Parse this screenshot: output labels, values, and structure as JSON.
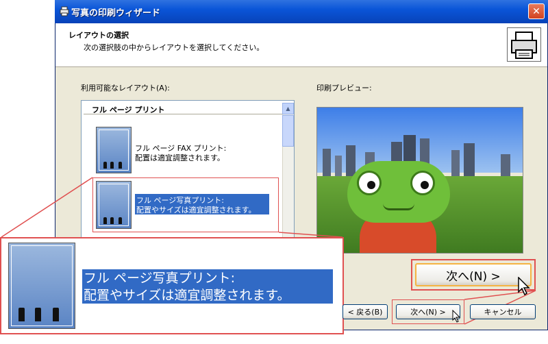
{
  "window": {
    "title": "写真の印刷ウィザード",
    "close_label": "✕"
  },
  "header": {
    "title": "レイアウトの選択",
    "subtitle": "次の選択肢の中からレイアウトを選択してください。"
  },
  "layouts": {
    "label": "利用可能なレイアウト(A):",
    "group": "フル ページ プリント",
    "items": [
      {
        "line1": "フル ページ FAX プリント:",
        "line2": "配置は適宜調整されます。"
      },
      {
        "line1": "フル ページ写真プリント:",
        "line2": "配置やサイズは適宜調整されます。"
      }
    ]
  },
  "preview": {
    "label": "印刷プレビュー:"
  },
  "zoom": {
    "line1": "フル ページ写真プリント:",
    "line2": "配置やサイズは適宜調整されます。"
  },
  "buttons": {
    "back": "< 戻る(B)",
    "next": "次へ(N) >",
    "cancel": "キャンセル",
    "next_zoom": "次へ(N) >"
  },
  "colors": {
    "title_bar": "#0a55d8",
    "selection": "#316ac5",
    "callout": "#e05050"
  }
}
